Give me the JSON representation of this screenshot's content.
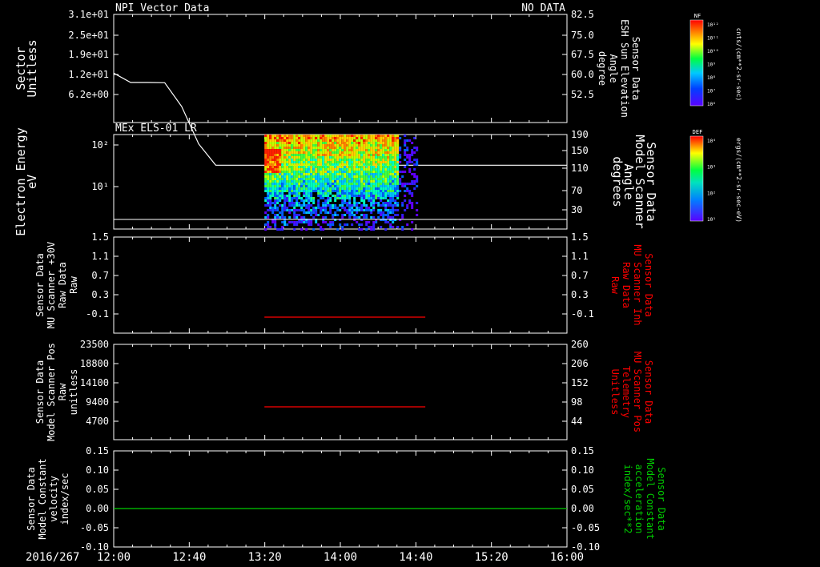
{
  "date_label": "2016/267",
  "time_ticks": [
    "12:00",
    "12:40",
    "13:20",
    "14:00",
    "14:40",
    "15:20",
    "16:00"
  ],
  "time_range_hours": [
    12.0,
    16.0
  ],
  "colors": {
    "background": "#000000",
    "axis": "#ffffff",
    "red_trace": "#ff0000",
    "green_trace": "#00cc00"
  },
  "panels": [
    {
      "id": "sector",
      "title_left": "NPI Vector Data",
      "title_right": "NO DATA",
      "left_label": [
        "Sector",
        "Unitless"
      ],
      "left_ticks": [
        "3.1e+01",
        "2.5e+01",
        "1.9e+01",
        "1.2e+01",
        "6.2e+00"
      ],
      "right_label": [
        "Sensor Data",
        "ESH Sun Elevation",
        "Angle",
        "degree"
      ],
      "right_ticks": [
        "82.5",
        "75.0",
        "67.5",
        "60.0",
        "52.5"
      ],
      "colorbar_label": "NF",
      "colorbar_ticks": [
        "10¹²",
        "10¹¹",
        "10¹⁰",
        "10⁹",
        "10⁸",
        "10⁷",
        "10⁶"
      ],
      "colorbar_units": "cnts/(cm**2-sr-sec)"
    },
    {
      "id": "els",
      "title_left": "MEx ELS-01 LR",
      "left_label": [
        "Electron Energy",
        "eV"
      ],
      "left_ticks": [
        "10²",
        "10¹"
      ],
      "right_label": [
        "Sensor Data",
        "Model Scanner",
        "Angle",
        "degrees"
      ],
      "right_ticks": [
        "190",
        "150",
        "110",
        "70",
        "30"
      ],
      "colorbar_label": "DEF",
      "colorbar_ticks": [
        "10⁴",
        "10³",
        "10²",
        "10¹"
      ],
      "colorbar_units": "ergs/(cm**2-sr-sec-eV)"
    },
    {
      "id": "mu_inh",
      "left_label": [
        "Sensor Data",
        "MU Scanner +30V",
        "Raw Data",
        "Raw"
      ],
      "left_ticks": [
        "1.5",
        "1.1",
        "0.7",
        "0.3",
        "-0.1"
      ],
      "right_label": [
        "Sensor Data",
        "MU Scanner Inh",
        "Raw Data",
        "Raw"
      ],
      "right_ticks": [
        "1.5",
        "1.1",
        "0.7",
        "0.3",
        "-0.1"
      ]
    },
    {
      "id": "mu_pos",
      "left_label": [
        "Sensor Data",
        "Model Scanner Pos",
        "Raw",
        "unitless"
      ],
      "left_ticks": [
        "23500",
        "18800",
        "14100",
        "9400",
        "4700"
      ],
      "right_label": [
        "Sensor Data",
        "MU Scanner Pos",
        "Telemetry",
        "Unitless"
      ],
      "right_ticks": [
        "260",
        "206",
        "152",
        "98",
        "44"
      ]
    },
    {
      "id": "model_const",
      "left_label": [
        "Sensor Data",
        "Model Constant",
        "velocity",
        "index/sec"
      ],
      "left_ticks": [
        "0.15",
        "0.10",
        "0.05",
        "0.00",
        "-0.05",
        "-0.10"
      ],
      "right_label": [
        "Sensor Data",
        "Model Constant",
        "acceleration",
        "index/sec**2"
      ],
      "right_ticks": [
        "0.15",
        "0.10",
        "0.05",
        "0.00",
        "-0.05",
        "-0.10"
      ]
    }
  ],
  "chart_data": [
    {
      "type": "line",
      "panel": "sector",
      "x_unit": "hours UT",
      "series": [
        {
          "x": [
            12.0,
            12.15,
            12.3,
            12.45,
            12.6,
            12.75,
            12.9,
            13.0,
            16.0
          ],
          "y": [
            60.5,
            57.0,
            57.0,
            56.9,
            48.0,
            34.0,
            26.0,
            26.0,
            26.0
          ]
        }
      ]
    },
    {
      "type": "heatmap",
      "panel": "els",
      "data_extent_hours": [
        13.33,
        14.67
      ],
      "ylabel": "Electron Energy eV"
    },
    {
      "type": "line",
      "panel": "mu_inh",
      "series": [
        {
          "x": [
            13.33,
            14.75
          ],
          "y": [
            0.0,
            0.0
          ]
        }
      ],
      "ylim": [
        -0.3,
        1.5
      ]
    },
    {
      "type": "line",
      "panel": "mu_pos",
      "series": [
        {
          "x": [
            13.33,
            14.75
          ],
          "y": [
            8100,
            8100
          ]
        }
      ],
      "ylim": [
        0,
        23500
      ]
    },
    {
      "type": "line",
      "panel": "model_const",
      "series": [
        {
          "x": [
            12.0,
            16.0
          ],
          "y": [
            0.0,
            0.0
          ]
        }
      ],
      "ylim": [
        -0.1,
        0.15
      ]
    }
  ]
}
